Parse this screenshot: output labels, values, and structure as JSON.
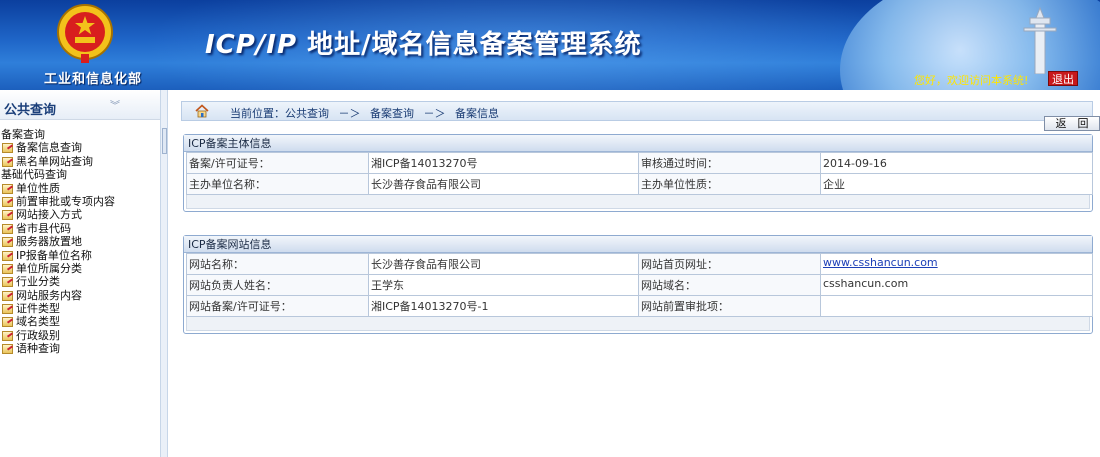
{
  "header": {
    "ministry": "工业和信息化部",
    "title_en": "ICP/IP",
    "title_cn": " 地址/域名信息备案管理系统",
    "welcome": "您好，欢迎访问本系统!",
    "logout": "退出"
  },
  "sidebar": {
    "title": "公共查询",
    "items": [
      {
        "label": "备案查询",
        "group": true
      },
      {
        "label": "备案信息查询",
        "group": false
      },
      {
        "label": "黑名单网站查询",
        "group": false
      },
      {
        "label": "基础代码查询",
        "group": true
      },
      {
        "label": "单位性质",
        "group": false
      },
      {
        "label": "前置审批或专项内容",
        "group": false
      },
      {
        "label": "网站接入方式",
        "group": false
      },
      {
        "label": "省市县代码",
        "group": false
      },
      {
        "label": "服务器放置地",
        "group": false
      },
      {
        "label": "IP报备单位名称",
        "group": false
      },
      {
        "label": "单位所属分类",
        "group": false
      },
      {
        "label": "行业分类",
        "group": false
      },
      {
        "label": "网站服务内容",
        "group": false
      },
      {
        "label": "证件类型",
        "group": false
      },
      {
        "label": "域名类型",
        "group": false
      },
      {
        "label": "行政级别",
        "group": false
      },
      {
        "label": "语种查询",
        "group": false
      }
    ]
  },
  "breadcrumb": {
    "current": "当前位置：公共查询",
    "sep1": "－＞",
    "level2": "备案查询",
    "sep2": "－＞",
    "level3": "备案信息"
  },
  "back_button": "返　回",
  "subject_panel": {
    "title": "ICP备案主体信息",
    "license_label": "备案/许可证号：",
    "license_value": "湘ICP备14013270号",
    "approve_time_label": "审核通过时间：",
    "approve_time_value": "2014-09-16",
    "org_name_label": "主办单位名称：",
    "org_name_value": "长沙善存食品有限公司",
    "org_type_label": "主办单位性质：",
    "org_type_value": "企业"
  },
  "site_panel": {
    "title": "ICP备案网站信息",
    "site_name_label": "网站名称：",
    "site_name_value": "长沙善存食品有限公司",
    "homepage_label": "网站首页网址：",
    "homepage_value": "www.csshancun.com",
    "owner_label": "网站负责人姓名：",
    "owner_value": "王学东",
    "domain_label": "网站域名：",
    "domain_value": "csshancun.com",
    "site_license_label": "网站备案/许可证号：",
    "site_license_value": "湘ICP备14013270号-1",
    "pre_approval_label": "网站前置审批项：",
    "pre_approval_value": ""
  },
  "colors": {
    "header_blue": "#1f66c8",
    "welcome_yellow": "#ffe600",
    "logout_red": "#c8191c",
    "link_blue": "#1c3fb7"
  }
}
